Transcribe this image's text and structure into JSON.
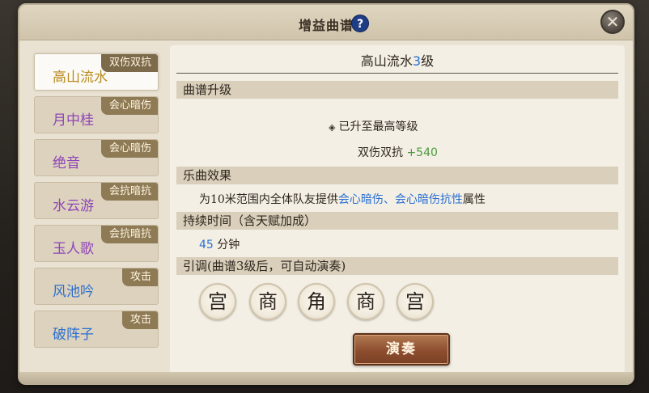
{
  "window": {
    "title": "增益曲谱",
    "help_icon": "?",
    "close_icon": "✕"
  },
  "songs": [
    {
      "name": "高山流水",
      "tag": "双伤双抗",
      "color": "#b98a1f",
      "active": true
    },
    {
      "name": "月中桂",
      "tag": "会心暗伤",
      "color": "#8f45b8",
      "active": false
    },
    {
      "name": "绝音",
      "tag": "会心暗伤",
      "color": "#8f45b8",
      "active": false
    },
    {
      "name": "水云游",
      "tag": "会抗暗抗",
      "color": "#8f45b8",
      "active": false
    },
    {
      "name": "玉人歌",
      "tag": "会抗暗抗",
      "color": "#8f45b8",
      "active": false
    },
    {
      "name": "风池吟",
      "tag": "攻击",
      "color": "#2a6fd1",
      "active": false
    },
    {
      "name": "破阵子",
      "tag": "攻击",
      "color": "#2a6fd1",
      "active": false
    }
  ],
  "detail": {
    "title_name": "高山流水",
    "title_level": "3",
    "title_suffix": "级",
    "upgrade_header": "曲谱升级",
    "max_level_text": "已升至最高等级",
    "stat_label": "双伤双抗",
    "stat_value": "+540",
    "effect_header": "乐曲效果",
    "effect_prefix": "为10米范围内全体队友提供",
    "effect_highlight": "会心暗伤、会心暗伤抗性",
    "effect_suffix": "属性",
    "duration_header": "持续时间（含天赋加成）",
    "duration_value": "45",
    "duration_unit": "分钟",
    "melody_header": "引调(曲谱3级后，可自动演奏)",
    "notes": [
      "宫",
      "商",
      "角",
      "商",
      "宫"
    ],
    "play_button": "演奏"
  }
}
